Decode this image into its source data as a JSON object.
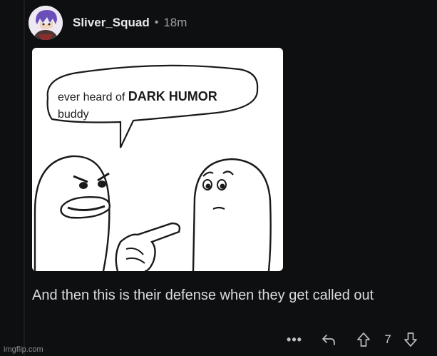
{
  "post": {
    "username": "Sliver_Squad",
    "separator": "•",
    "time": "18m",
    "avatar_icon": "user-avatar"
  },
  "image": {
    "speech_line1_prefix": "ever heard of",
    "speech_line1_bold": "DARK HUMOR",
    "speech_line2": "buddy"
  },
  "comment": {
    "text": "And then this is their defense when they get called out"
  },
  "actions": {
    "more_label": "•••",
    "score": "7"
  },
  "watermark": "imgflip.com",
  "colors": {
    "background": "#0e0f11",
    "text": "#d9dbdd",
    "muted": "#9aa0a6",
    "card": "#ffffff"
  }
}
